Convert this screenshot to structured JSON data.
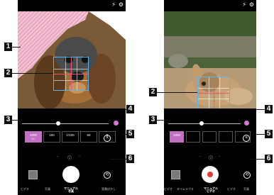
{
  "callouts": [
    "1",
    "2",
    "3",
    "4",
    "5",
    "6"
  ],
  "left_screen": {
    "status_icons": [
      "flash-off-icon",
      "gear-icon"
    ],
    "chips": [
      {
        "value": "4000",
        "sub": "ISO",
        "active": true
      },
      {
        "value": "100",
        "sub": "",
        "active": false
      },
      {
        "value": "1/100",
        "sub": "",
        "active": false
      },
      {
        "value": "50",
        "sub": "",
        "active": false
      },
      {
        "value": "5",
        "sub": "",
        "active": false
      }
    ],
    "close_label": "×",
    "info_icon": "ⓘ",
    "shutter_mode": "photo",
    "modes": [
      "ビデオ",
      "写真",
      "マニュアル\n写真",
      "背景ぼかし"
    ],
    "selected_mode_index": 2,
    "accent_color": "#c36fc4",
    "focus_color": "#58b4f0"
  },
  "right_screen": {
    "status_icons": [
      "flash-off-icon",
      "gear-icon"
    ],
    "chips": [
      {
        "value": "4000",
        "sub": "",
        "active": true
      },
      {
        "value": "",
        "sub": "",
        "active": false
      },
      {
        "value": "",
        "sub": "",
        "active": false
      },
      {
        "value": "",
        "sub": "",
        "active": false
      },
      {
        "value": "",
        "sub": "",
        "active": false
      }
    ],
    "close_label": "×",
    "info_icon": "ⓘ",
    "shutter_mode": "video",
    "modes": [
      "ビデオ",
      "タイムラプス",
      "マニュアル\nビデオ",
      "ビデオ",
      "写真"
    ],
    "selected_mode_index": 2,
    "record_color": "#e53935"
  }
}
